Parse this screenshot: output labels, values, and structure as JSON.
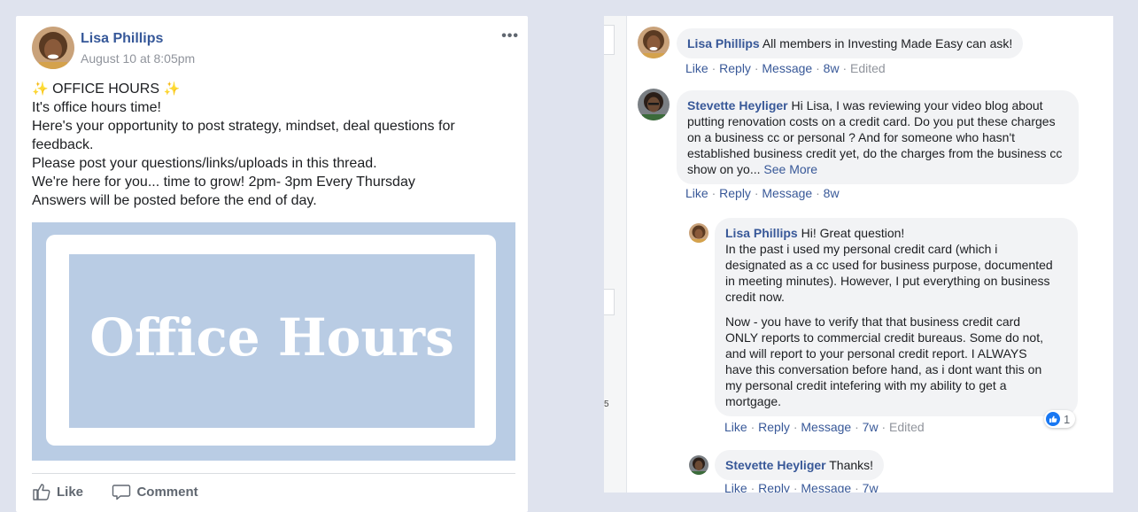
{
  "post": {
    "author": "Lisa Phillips",
    "timestamp": "August 10 at 8:05pm",
    "menu_label": "•••",
    "body_lines": {
      "l1_sparkle_left": "✨",
      "l1_text": " OFFICE HOURS ",
      "l1_sparkle_right": "✨",
      "l2": "It's office hours time!",
      "l3": "Here's your opportunity to post strategy, mindset, deal questions for",
      "l4": "feedback.",
      "l5": "Please post your questions/links/uploads in this thread.",
      "l6": "We're here for you... time to grow! 2pm- 3pm Every Thursday",
      "l7": "Answers will be posted before the end of day."
    },
    "image_text": "Office Hours",
    "actions": {
      "like": "Like",
      "comment": "Comment"
    }
  },
  "side_strip": {
    "glyph": "5"
  },
  "comments": [
    {
      "author": "Lisa Phillips",
      "text": "All members in Investing Made Easy can ask!",
      "meta": {
        "like": "Like",
        "reply": "Reply",
        "message": "Message",
        "age": "8w",
        "edited": "Edited"
      }
    },
    {
      "author": "Stevette Heyliger",
      "text_lines": [
        "Hi Lisa, I was reviewing your video blog about",
        "putting renovation costs on a credit card. Do you put these charges",
        "on a business cc or personal ? And for someone who hasn't",
        "established business credit yet, do the charges from the business cc",
        "show on yo..."
      ],
      "see_more": "See More",
      "meta": {
        "like": "Like",
        "reply": "Reply",
        "message": "Message",
        "age": "8w"
      }
    }
  ],
  "replies": [
    {
      "author": "Lisa Phillips",
      "first_line": "Hi! Great question!",
      "para1_lines": [
        "In the past i used my personal credit card (which i",
        "designated as a cc used for business purpose, documented",
        "in meeting minutes). However, I put everything on business",
        "credit now."
      ],
      "para2_lines": [
        "Now - you have to verify that that business credit card",
        "ONLY reports to commercial credit bureaus. Some do not,",
        "and will report to your personal credit report. I ALWAYS",
        "have this conversation before hand, as i dont want this on",
        "my personal credit intefering with my ability to get a",
        "mortgage."
      ],
      "reaction_count": "1",
      "meta": {
        "like": "Like",
        "reply": "Reply",
        "message": "Message",
        "age": "7w",
        "edited": "Edited"
      }
    },
    {
      "author": "Stevette Heyliger",
      "text": "Thanks!",
      "meta": {
        "like": "Like",
        "reply": "Reply",
        "message": "Message",
        "age": "7w"
      }
    }
  ],
  "colors": {
    "page_bg": "#dfe3ee",
    "link_blue": "#385898",
    "bubble_bg": "#f2f3f5",
    "image_blue": "#b9cce4",
    "like_blue": "#1877f2"
  }
}
